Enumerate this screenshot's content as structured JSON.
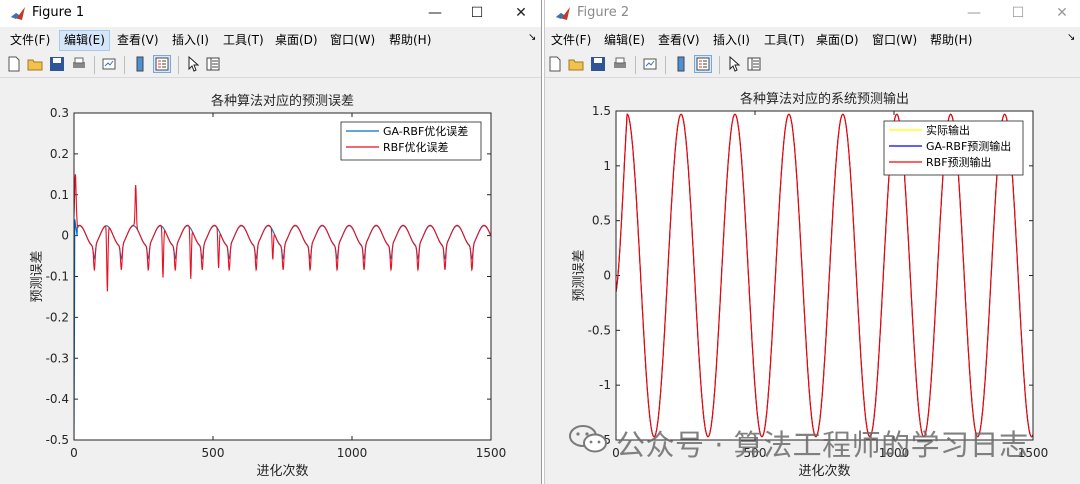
{
  "window1": {
    "title": "Figure 1",
    "menus": [
      "文件(F)",
      "编辑(E)",
      "查看(V)",
      "插入(I)",
      "工具(T)",
      "桌面(D)",
      "窗口(W)",
      "帮助(H)"
    ],
    "active_menu": 1
  },
  "window2": {
    "title": "Figure 2",
    "menus": [
      "文件(F)",
      "编辑(E)",
      "查看(V)",
      "插入(I)",
      "工具(T)",
      "桌面(D)",
      "窗口(W)",
      "帮助(H)"
    ]
  },
  "window_controls": {
    "minimize": "—",
    "maximize": "☐",
    "close": "✕"
  },
  "toolbar_icons": [
    "new-figure-icon",
    "open-icon",
    "save-icon",
    "print-icon",
    "link-plot-icon",
    "colorbar-icon",
    "legend-icon",
    "select-arrow-icon",
    "property-inspector-icon"
  ],
  "watermark": "公众号 · 算法工程师的学习日志",
  "chart_data": [
    {
      "type": "line",
      "title": "各种算法对应的预测误差",
      "xlabel": "进化次数",
      "ylabel": "预测误差",
      "xlim": [
        0,
        1500
      ],
      "ylim": [
        -0.5,
        0.3
      ],
      "xticks": [
        0,
        500,
        1000,
        1500
      ],
      "yticks": [
        0.3,
        0.2,
        0.1,
        0,
        -0.1,
        -0.2,
        -0.3,
        -0.4,
        -0.5
      ],
      "legend_position": "top-right",
      "series": [
        {
          "name": "GA-RBF优化误差",
          "color": "#0072bd"
        },
        {
          "name": "RBF优化误差",
          "color": "#e81123"
        }
      ],
      "periodic_error": {
        "period": 97,
        "first_peak_x": 20,
        "amplitude_smooth": 0.024,
        "spike_depth": 0.06,
        "spike_width": 5,
        "rbf_spikes": [
          {
            "x": 120,
            "y": -0.215
          },
          {
            "x": 222,
            "y": 0.12
          },
          {
            "x": 320,
            "y": -0.165
          },
          {
            "x": 420,
            "y": -0.165
          },
          {
            "x": 520,
            "y": -0.125
          },
          {
            "x": 715,
            "y": -0.095
          }
        ],
        "start_values": {
          "ga_min": -0.5,
          "rbf_peak": 0.13
        }
      }
    },
    {
      "type": "line",
      "title": "各种算法对应的系统预测输出",
      "xlabel": "进化次数",
      "ylabel": "预测误差",
      "xlim": [
        0,
        1500
      ],
      "ylim": [
        -1.5,
        1.5
      ],
      "xticks": [
        0,
        500,
        1000,
        1500
      ],
      "yticks": [
        1.5,
        1,
        0.5,
        0,
        -0.5,
        -1,
        -1.5
      ],
      "legend_position": "top-right",
      "series": [
        {
          "name": "实际输出",
          "color": "#ffff00"
        },
        {
          "name": "GA-RBF预测输出",
          "color": "#0000ff"
        },
        {
          "name": "RBF预测输出",
          "color": "#ff0000"
        }
      ],
      "waveform": {
        "period": 194,
        "amplitude": 1.47,
        "first_peak_x": 40,
        "start_y": -0.15
      }
    }
  ]
}
